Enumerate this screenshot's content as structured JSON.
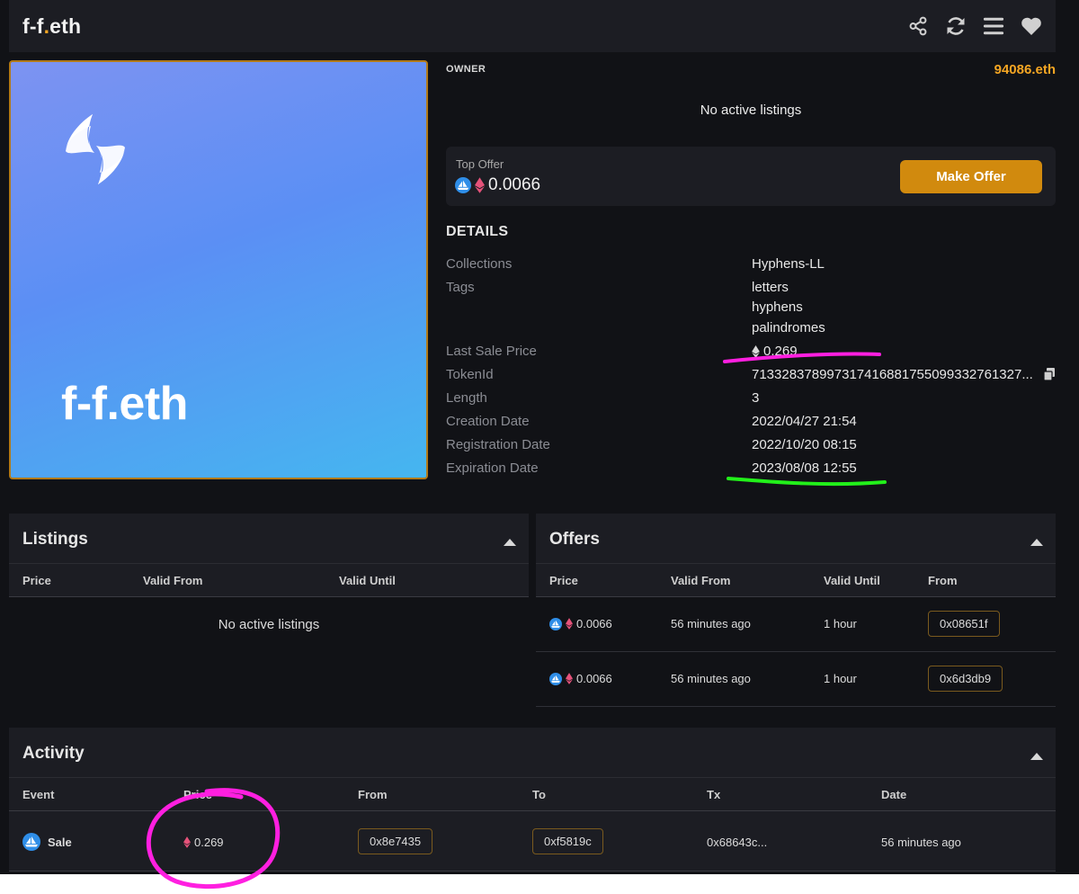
{
  "header": {
    "logo_a": "f-f",
    "logo_dot": ".",
    "logo_b": "eth"
  },
  "nft": {
    "name": "f-f.eth"
  },
  "owner": {
    "label": "OWNER",
    "value": "94086.eth"
  },
  "listing_status": "No active listings",
  "top_offer": {
    "label": "Top Offer",
    "price": "0.0066",
    "button": "Make Offer"
  },
  "details": {
    "title": "DETAILS",
    "collections_label": "Collections",
    "collections_value": "Hyphens-LL",
    "tags_label": "Tags",
    "tags": [
      "letters",
      "hyphens",
      "palindromes"
    ],
    "last_sale_label": "Last Sale Price",
    "last_sale_value": "0.269",
    "tokenid_label": "TokenId",
    "tokenid_value": "713328378997317416881755099332761327...",
    "length_label": "Length",
    "length_value": "3",
    "creation_label": "Creation Date",
    "creation_value": "2022/04/27 21:54",
    "registration_label": "Registration Date",
    "registration_value": "2022/10/20 08:15",
    "expiration_label": "Expiration Date",
    "expiration_value": "2023/08/08 12:55"
  },
  "listings": {
    "title": "Listings",
    "columns": [
      "Price",
      "Valid From",
      "Valid Until"
    ],
    "empty": "No active listings"
  },
  "offers": {
    "title": "Offers",
    "columns": [
      "Price",
      "Valid From",
      "Valid Until",
      "From"
    ],
    "rows": [
      {
        "price": "0.0066",
        "valid_from": "56 minutes ago",
        "valid_until": "1 hour",
        "from": "0x08651f"
      },
      {
        "price": "0.0066",
        "valid_from": "56 minutes ago",
        "valid_until": "1 hour",
        "from": "0x6d3db9"
      }
    ]
  },
  "activity": {
    "title": "Activity",
    "columns": [
      "Event",
      "Price",
      "From",
      "To",
      "Tx",
      "Date"
    ],
    "rows": [
      {
        "event": "Sale",
        "price": "0.269",
        "from": "0x8e7435",
        "to": "0xf5819c",
        "tx": "0x68643c...",
        "date": "56 minutes ago"
      }
    ]
  },
  "colors": {
    "accent": "#f5a623",
    "button": "#d18a0e",
    "annotation_magenta": "#ff1fe0",
    "annotation_green": "#22f01a"
  }
}
